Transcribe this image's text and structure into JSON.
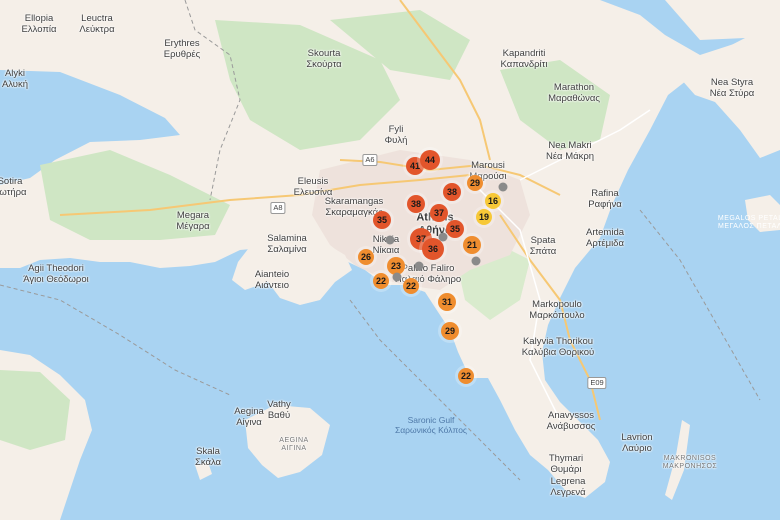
{
  "colors": {
    "sea": "#a9d3f2",
    "land": "#f7f2ec",
    "green": "#cde8c2",
    "urban": "#efe4df",
    "aqi_red": "#e2552b",
    "aqi_orange": "#ef8d2f",
    "aqi_yellow": "#f7c837",
    "aqi_gray": "#8a8a8a"
  },
  "places": [
    {
      "id": "ellopia",
      "en": "Ellopia",
      "gr": "Ελλοπία",
      "kind": "town"
    },
    {
      "id": "leuctra",
      "en": "Leuctra",
      "gr": "Λεύκτρα",
      "kind": "town"
    },
    {
      "id": "erythres",
      "en": "Erythres",
      "gr": "Ερυθρές",
      "kind": "town"
    },
    {
      "id": "skourta",
      "en": "Skourta",
      "gr": "Σκούρτα",
      "kind": "town"
    },
    {
      "id": "kapandriti",
      "en": "Kapandriti",
      "gr": "Καπανδρίτι",
      "kind": "town"
    },
    {
      "id": "alyki",
      "en": "Alyki",
      "gr": "Αλυκή",
      "kind": "town"
    },
    {
      "id": "marathon",
      "en": "Marathon",
      "gr": "Μαραθώνας",
      "kind": "town"
    },
    {
      "id": "neastyra",
      "en": "Nea Styra",
      "gr": "Νέα Στύρα",
      "kind": "town"
    },
    {
      "id": "fyli",
      "en": "Fyli",
      "gr": "Φυλή",
      "kind": "town"
    },
    {
      "id": "neamakri",
      "en": "Nea Makri",
      "gr": "Νέα Μάκρη",
      "kind": "town"
    },
    {
      "id": "marousi",
      "en": "Marousi",
      "gr": "Μαρούσι",
      "kind": "town"
    },
    {
      "id": "eleusis",
      "en": "Eleusis",
      "gr": "Ελευσίνα",
      "kind": "town"
    },
    {
      "id": "sotira",
      "en": "Sotira",
      "gr": "Σωτήρα",
      "kind": "town"
    },
    {
      "id": "rafina",
      "en": "Rafina",
      "gr": "Ραφήνα",
      "kind": "town"
    },
    {
      "id": "skaramangas",
      "en": "Skaramangas",
      "gr": "Σκαραμαγκάς",
      "kind": "town"
    },
    {
      "id": "athens",
      "en": "Athens",
      "gr": "Αθήνα",
      "kind": "city"
    },
    {
      "id": "megara",
      "en": "Megara",
      "gr": "Μέγαρα",
      "kind": "town"
    },
    {
      "id": "artemida",
      "en": "Artemida",
      "gr": "Αρτέμιδα",
      "kind": "town"
    },
    {
      "id": "salamina",
      "en": "Salamina",
      "gr": "Σαλαμίνα",
      "kind": "town"
    },
    {
      "id": "nikaia",
      "en": "Nikaia",
      "gr": "Νίκαια",
      "kind": "town"
    },
    {
      "id": "spata",
      "en": "Spata",
      "gr": "Σπάτα",
      "kind": "town"
    },
    {
      "id": "agiitheodori",
      "en": "Agii Theodori",
      "gr": "Άγιοι Θεόδωροι",
      "kind": "town"
    },
    {
      "id": "aianteio",
      "en": "Aianteio",
      "gr": "Αιάντειο",
      "kind": "town"
    },
    {
      "id": "paleofaliro",
      "en": "Palaio Faliro",
      "gr": "Παλαιό Φάληρο",
      "kind": "town"
    },
    {
      "id": "markopoulo",
      "en": "Markopoulo",
      "gr": "Μαρκόπουλο",
      "kind": "town"
    },
    {
      "id": "kalyvia",
      "en": "Kalyvia Thorikou",
      "gr": "Καλύβια Θορικού",
      "kind": "town"
    },
    {
      "id": "vathy",
      "en": "Vathy",
      "gr": "Βαθύ",
      "kind": "town"
    },
    {
      "id": "aegina",
      "en": "Aegina",
      "gr": "Αίγινα",
      "kind": "town"
    },
    {
      "id": "saronic",
      "en": "Saronic Gulf",
      "gr": "Σαρωνικός Κόλπος",
      "kind": "water"
    },
    {
      "id": "anavyssos",
      "en": "Anavyssos",
      "gr": "Ανάβυσσος",
      "kind": "town"
    },
    {
      "id": "aeginaisland",
      "en": "AEGINA",
      "gr": "ΑΙΓΙΝΑ",
      "kind": "island"
    },
    {
      "id": "lavrion",
      "en": "Lavrion",
      "gr": "Λαύριο",
      "kind": "town"
    },
    {
      "id": "skala",
      "en": "Skala",
      "gr": "Σκάλα",
      "kind": "town"
    },
    {
      "id": "makronisos",
      "en": "MAKRONISOS",
      "gr": "ΜΑΚΡΟΝΗΣΟΣ",
      "kind": "island"
    },
    {
      "id": "thymari",
      "en": "Thymari",
      "gr": "Θυμάρι",
      "kind": "town"
    },
    {
      "id": "legrena",
      "en": "Legrena",
      "gr": "Λεγρενά",
      "kind": "town"
    },
    {
      "id": "petalion",
      "en": "MEGALOS PETALIOS",
      "gr": "ΜΕΓΑΛΟΣ ΠΕΤΑΛΙΟΝ",
      "kind": "water2"
    }
  ],
  "roads": [
    "A6",
    "A8",
    "E09"
  ],
  "markers": [
    {
      "value": "41",
      "level": "red"
    },
    {
      "value": "44",
      "level": "red"
    },
    {
      "value": "38",
      "level": "red"
    },
    {
      "value": "29",
      "level": "orange"
    },
    {
      "value": "38",
      "level": "red"
    },
    {
      "value": "16",
      "level": "yellow"
    },
    {
      "value": "37",
      "level": "red"
    },
    {
      "value": "35",
      "level": "red"
    },
    {
      "value": "19",
      "level": "yellow"
    },
    {
      "value": "35",
      "level": "red"
    },
    {
      "value": "37",
      "level": "red"
    },
    {
      "value": "36",
      "level": "red"
    },
    {
      "value": "21",
      "level": "orange"
    },
    {
      "value": "26",
      "level": "orange"
    },
    {
      "value": "23",
      "level": "orange"
    },
    {
      "value": "22",
      "level": "orange"
    },
    {
      "value": "22",
      "level": "orange"
    },
    {
      "value": "31",
      "level": "orange"
    },
    {
      "value": "29",
      "level": "orange"
    },
    {
      "value": "22",
      "level": "orange"
    }
  ]
}
